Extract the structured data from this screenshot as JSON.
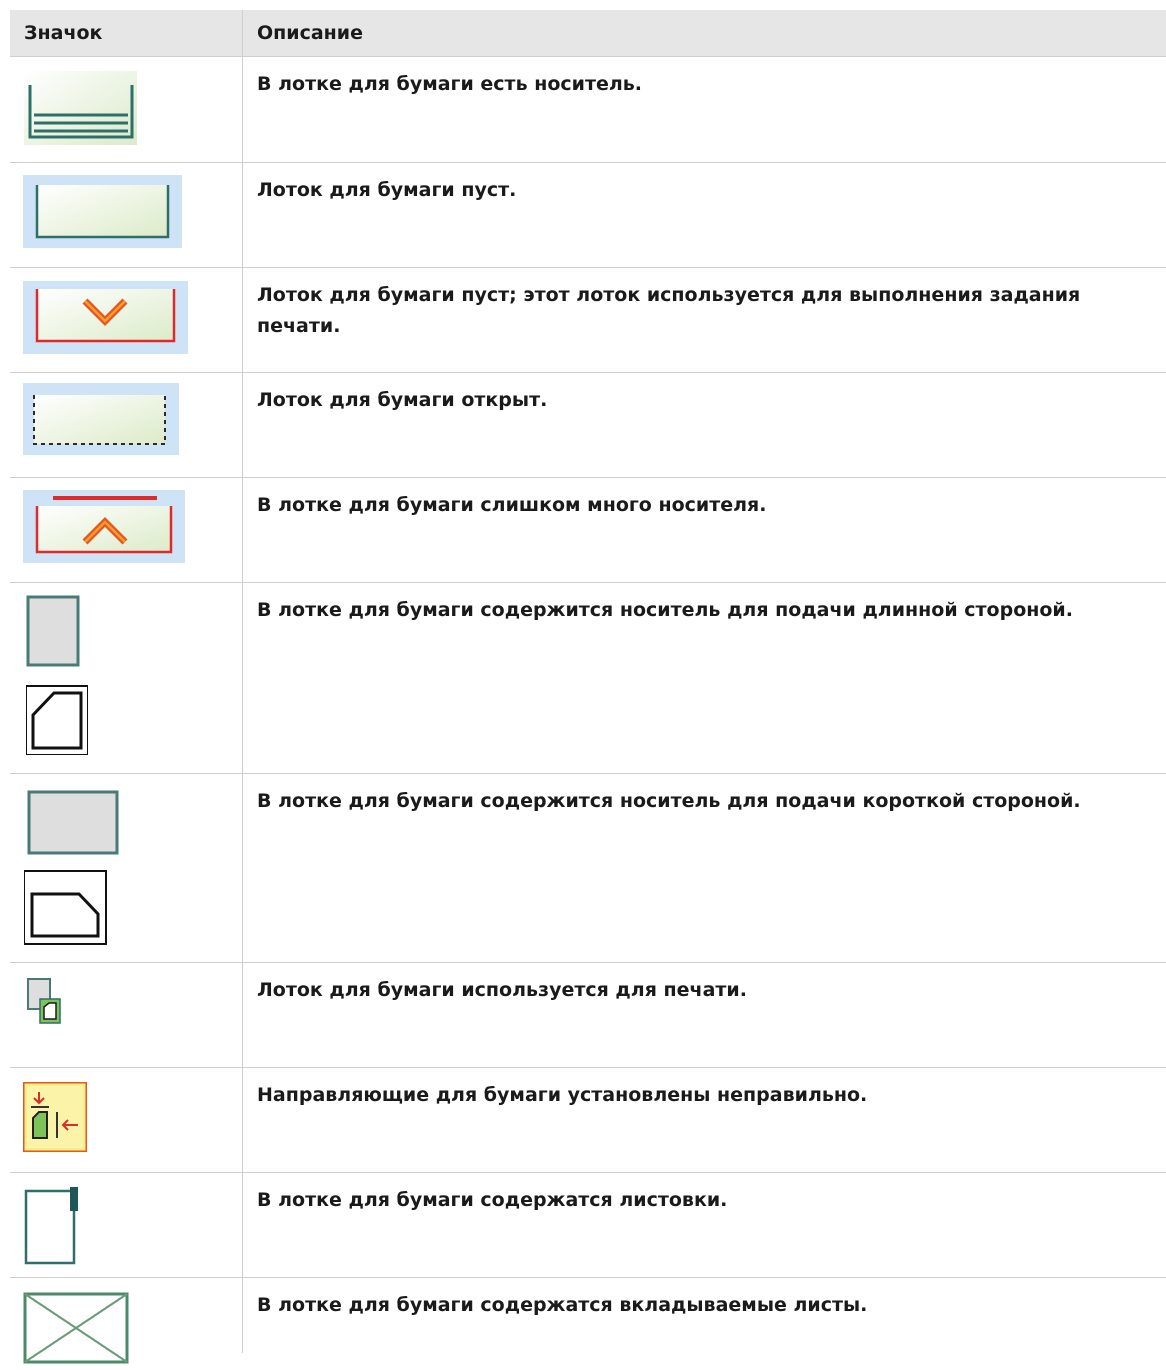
{
  "header": {
    "col_icon": "Значок",
    "col_desc": "Описание"
  },
  "rows": [
    {
      "icon": "tray-with-media-icon",
      "text": "В лотке для бумаги есть носитель."
    },
    {
      "icon": "tray-empty-icon",
      "text": "Лоток для бумаги пуст."
    },
    {
      "icon": "tray-empty-in-use-icon",
      "text": "Лоток для бумаги пуст; этот лоток используется для выполнения задания печати."
    },
    {
      "icon": "tray-open-icon",
      "text": "Лоток для бумаги открыт."
    },
    {
      "icon": "tray-overfilled-icon",
      "text": "В лотке для бумаги слишком много носителя."
    },
    {
      "icon": "long-edge-feed-icon",
      "text": "В лотке для бумаги содержится носитель для подачи длинной стороной."
    },
    {
      "icon": "short-edge-feed-icon",
      "text": "В лотке для бумаги содержится носитель для подачи короткой стороной."
    },
    {
      "icon": "tray-printing-icon",
      "text": "Лоток для бумаги используется для печати."
    },
    {
      "icon": "paper-guides-wrong-icon",
      "text": "Направляющие для бумаги установлены неправильно."
    },
    {
      "icon": "tab-sheets-icon",
      "text": "В лотке для бумаги содержатся листовки."
    },
    {
      "icon": "inserts-icon",
      "text": "В лотке для бумаги содержатся вкладываемые листы."
    }
  ],
  "colors": {
    "header_bg": "#e6e6e6",
    "grid": "#cfcfcf",
    "tray_blue": "#cfe3f7",
    "tray_green": "#e4efd6",
    "alert_red": "#e02a2a",
    "teal_border": "#2f6f6a"
  }
}
